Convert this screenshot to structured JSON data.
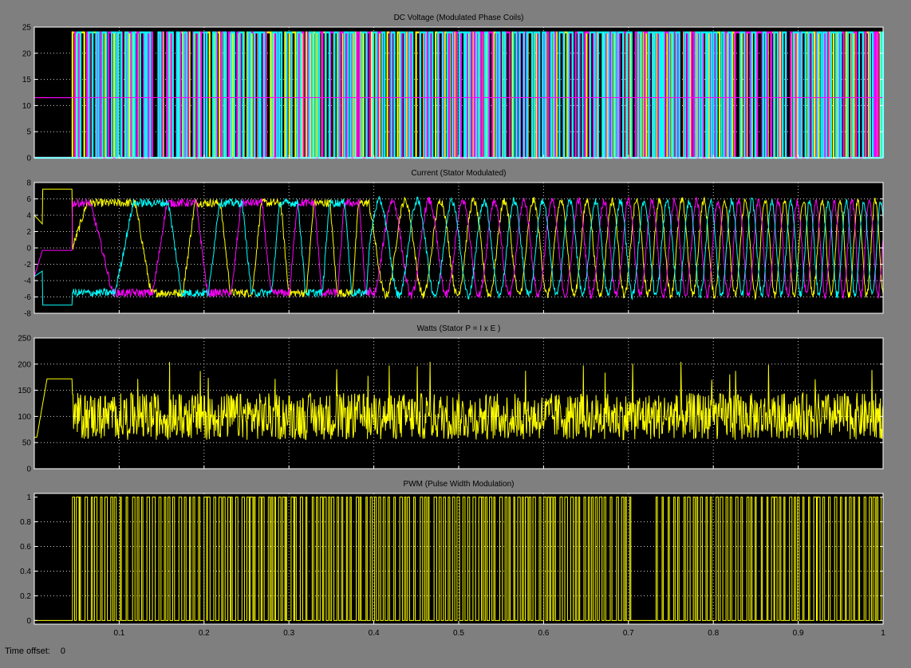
{
  "window": {
    "status_label": "Time offset:",
    "status_value": "0"
  },
  "colors": {
    "background": "#7f7f7f",
    "axes_bg": "#000000",
    "axes_edge": "#ffffff",
    "grid": "#cfcfcf",
    "yellow": "#ffff00",
    "magenta": "#ff00ff",
    "cyan": "#00ffff"
  },
  "chart_data": [
    {
      "type": "line",
      "title": "DC Voltage (Modulated Phase Coils)",
      "xlim": [
        0,
        1.0
      ],
      "ylim": [
        0,
        25
      ],
      "yticks": [
        0,
        5,
        10,
        15,
        20,
        25
      ],
      "xticks": [],
      "grid": true,
      "series": [
        {
          "color": "yellow",
          "kind": "pwm",
          "low": 0,
          "high": 24,
          "start": 0.045,
          "period": 0.0085,
          "duty": 0.5,
          "phase": 0.0
        },
        {
          "color": "magenta",
          "kind": "pwm",
          "low": 0,
          "high": 24,
          "start": 0.045,
          "period": 0.0085,
          "duty": 0.5,
          "phase": 0.33
        },
        {
          "color": "cyan",
          "kind": "pwm",
          "low": 0,
          "high": 24,
          "start": 0.045,
          "period": 0.0085,
          "duty": 0.5,
          "phase": 0.66
        }
      ],
      "baseline": {
        "color": "magenta",
        "y": 11.5,
        "x_end": 0.045
      }
    },
    {
      "type": "line",
      "title": "Current (Stator Modulated)",
      "xlim": [
        0,
        1.0
      ],
      "ylim": [
        -8,
        8
      ],
      "yticks": [
        -8,
        -6,
        -4,
        -2,
        0,
        2,
        4,
        6,
        8
      ],
      "xticks": [],
      "grid": true,
      "series": [
        {
          "color": "yellow",
          "kind": "current",
          "initial": 7.2,
          "amplitude": 5.5,
          "phase": 0.0
        },
        {
          "color": "magenta",
          "kind": "current",
          "initial": -0.3,
          "amplitude": 5.5,
          "phase": 2.094
        },
        {
          "color": "cyan",
          "kind": "current",
          "initial": -7.0,
          "amplitude": 5.5,
          "phase": 4.189
        }
      ]
    },
    {
      "type": "line",
      "title": "Watts (Stator P = I x E )",
      "xlim": [
        0,
        1.0
      ],
      "ylim": [
        0,
        250
      ],
      "yticks": [
        0,
        50,
        100,
        150,
        200,
        250
      ],
      "xticks": [],
      "grid": true,
      "series": [
        {
          "color": "yellow",
          "kind": "power",
          "initial": 172,
          "mean": 100,
          "spread": 45
        }
      ]
    },
    {
      "type": "line",
      "title": "PWM (Pulse Width Modulation)",
      "xlim": [
        0,
        1.0
      ],
      "ylim": [
        -0.03,
        1.03
      ],
      "yticks": [
        0,
        0.2,
        0.4,
        0.6,
        0.8,
        1
      ],
      "xticks": [
        0.1,
        0.2,
        0.3,
        0.4,
        0.5,
        0.6,
        0.7,
        0.8,
        0.9,
        1
      ],
      "grid": true,
      "series": [
        {
          "color": "yellow",
          "kind": "pwm",
          "low": 0,
          "high": 1,
          "start": 0.045,
          "period": 0.0045,
          "duty": 0.5,
          "phase": 0.0,
          "gap": [
            0.702,
            0.732
          ]
        }
      ]
    }
  ]
}
